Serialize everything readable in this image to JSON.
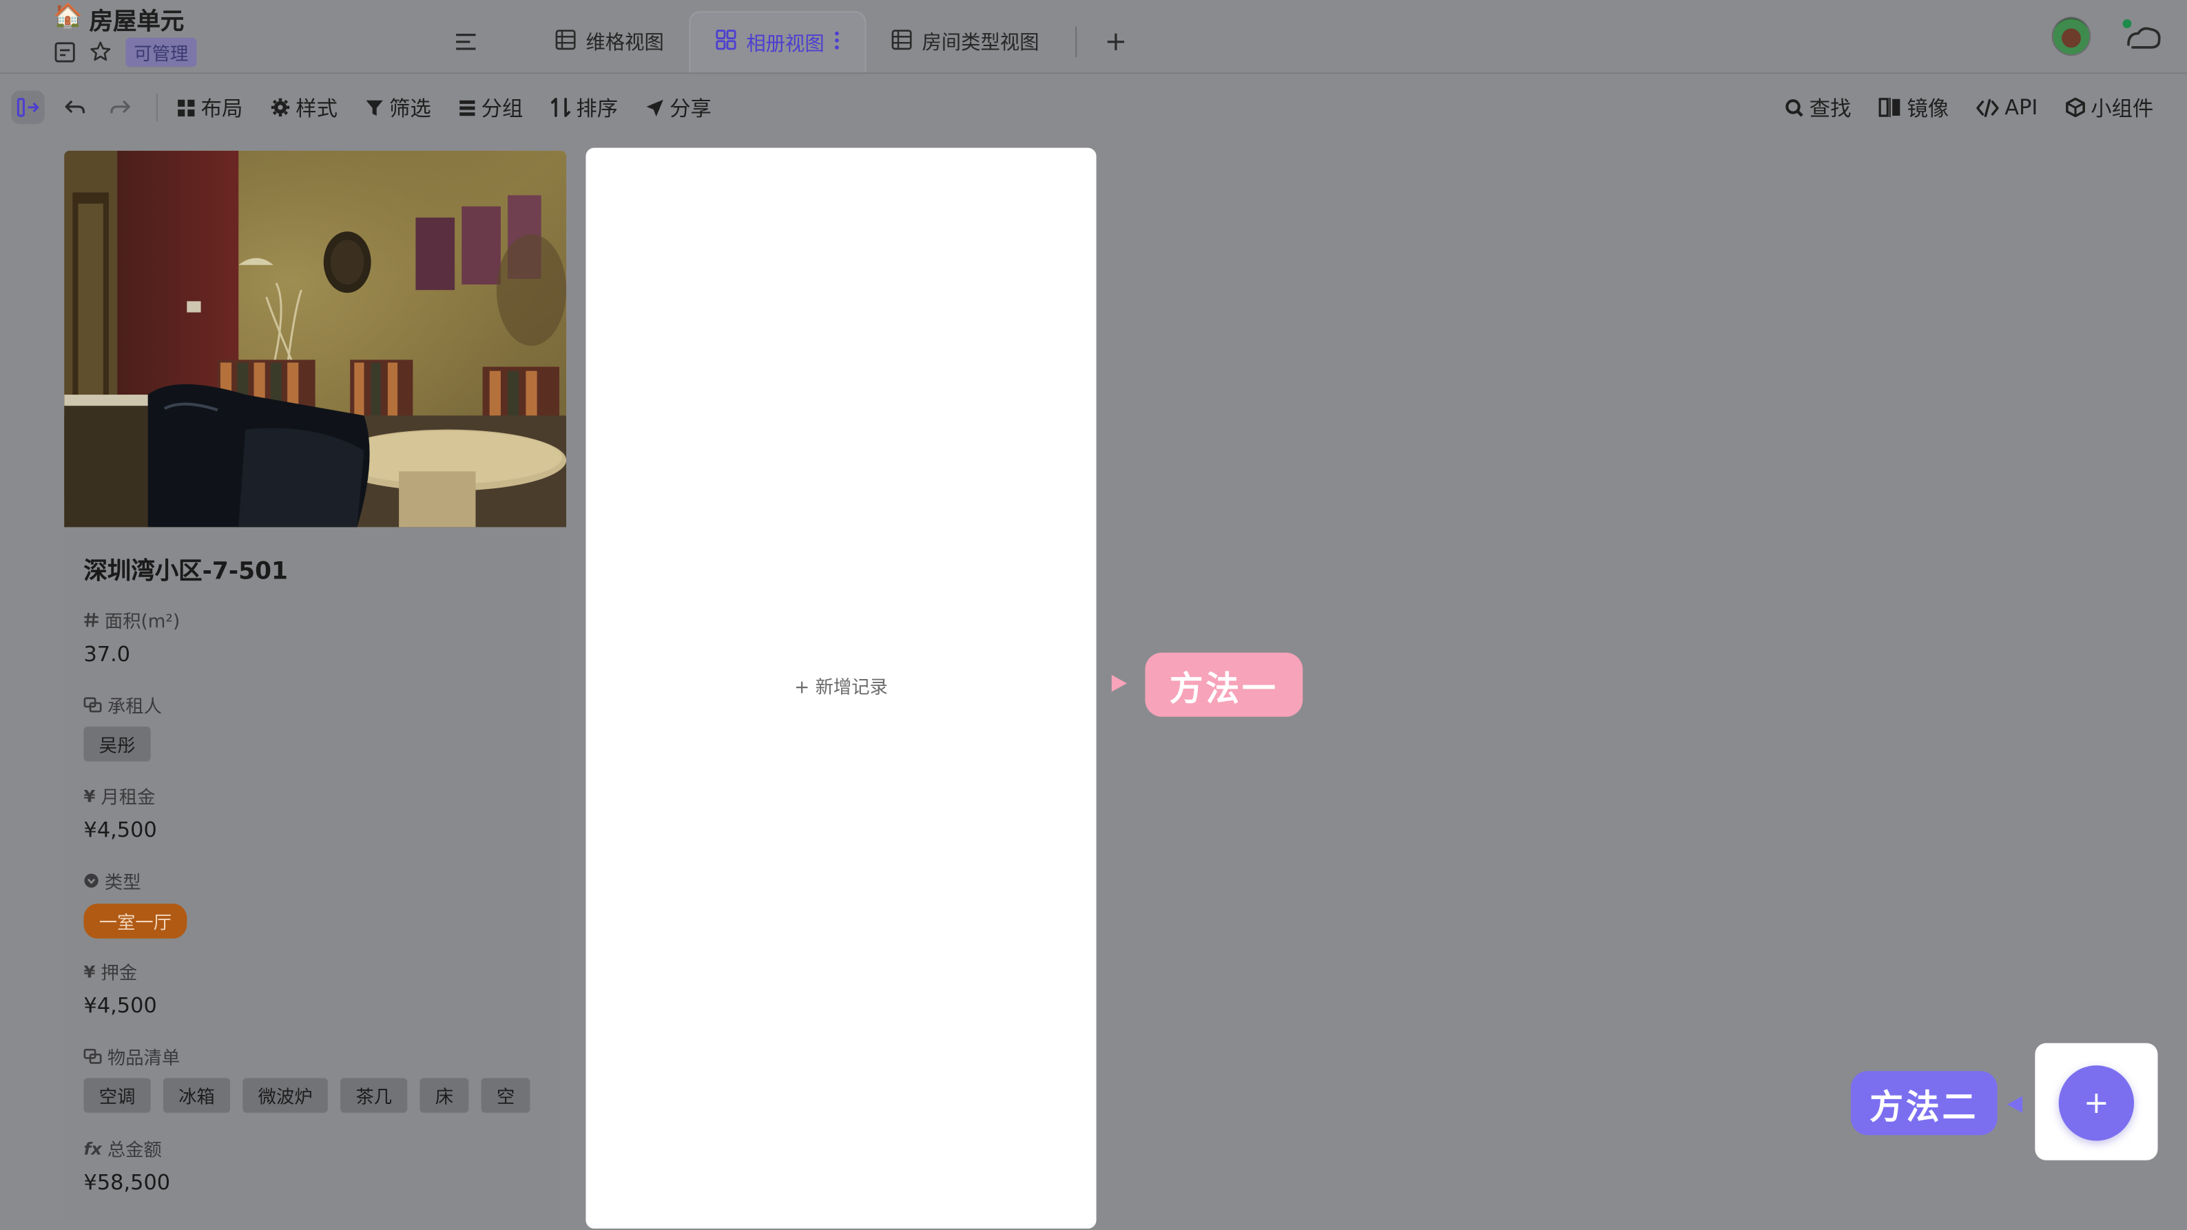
{
  "header": {
    "title_icon": "🏠",
    "title": "房屋单元",
    "badge": "可管理"
  },
  "tabs": [
    {
      "label": "维格视图",
      "icon": "grid-view-icon",
      "active": false
    },
    {
      "label": "相册视图",
      "icon": "gallery-view-icon",
      "active": true
    },
    {
      "label": "房间类型视图",
      "icon": "grid-view-icon",
      "active": false
    }
  ],
  "toolbar": {
    "left": [
      {
        "label": "布局",
        "icon": "layout-icon"
      },
      {
        "label": "样式",
        "icon": "gear-icon"
      },
      {
        "label": "筛选",
        "icon": "filter-icon"
      },
      {
        "label": "分组",
        "icon": "group-icon"
      },
      {
        "label": "排序",
        "icon": "sort-icon"
      },
      {
        "label": "分享",
        "icon": "share-icon"
      }
    ],
    "right": [
      {
        "label": "查找",
        "icon": "search-icon"
      },
      {
        "label": "镜像",
        "icon": "mirror-icon"
      },
      {
        "label": "API",
        "icon": "code-icon"
      },
      {
        "label": "小组件",
        "icon": "widget-icon"
      }
    ]
  },
  "record": {
    "title": "深圳湾小区-7-501",
    "fields": {
      "area": {
        "label": "面积(m²)",
        "value": "37.0"
      },
      "tenant": {
        "label": "承租人",
        "value": "吴彤"
      },
      "rent": {
        "label": "月租金",
        "value": "¥4,500"
      },
      "type": {
        "label": "类型",
        "value": "一室一厅"
      },
      "deposit": {
        "label": "押金",
        "value": "¥4,500"
      },
      "items": {
        "label": "物品清单",
        "values": [
          "空调",
          "冰箱",
          "微波炉",
          "茶几",
          "床",
          "空"
        ]
      },
      "total": {
        "label": "总金额",
        "value": "¥58,500"
      }
    }
  },
  "blank_card": {
    "add_label": "+ 新增记录"
  },
  "callouts": {
    "method1": "方法一",
    "method2": "方法二"
  },
  "fab": {
    "label": "+"
  },
  "colors": {
    "overlay": "#8a8b8e",
    "accent_purple": "#7b6ff0",
    "callout_pink": "#f7a3b9",
    "type_tag": "#b15a14"
  }
}
